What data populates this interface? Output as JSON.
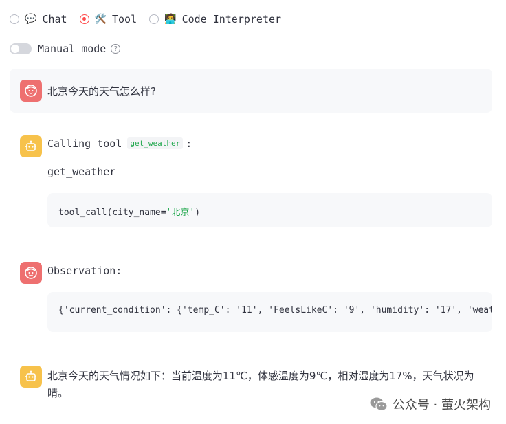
{
  "modes": [
    {
      "label": "Chat",
      "emoji": "💬",
      "selected": false
    },
    {
      "label": "Tool",
      "emoji": "🛠️",
      "selected": true
    },
    {
      "label": "Code Interpreter",
      "emoji": "🧑‍💻",
      "selected": false
    }
  ],
  "manual_mode": {
    "label": "Manual mode",
    "help": "?",
    "enabled": false
  },
  "user_message": "北京今天的天气怎么样?",
  "tool_call": {
    "heading": "Calling tool",
    "tag": "get_weather",
    "colon": ":",
    "name": "get_weather",
    "code_fn": "tool_call(city_name=",
    "code_arg": "'北京'",
    "code_close": ")"
  },
  "observation": {
    "heading": "Observation:",
    "text": "{'current_condition': {'temp_C': '11', 'FeelsLikeC': '9', 'humidity': '17', 'weatherDesc': [{'value': 'Sunny'}]}}"
  },
  "final_answer": "北京今天的天气情况如下：当前温度为11℃，体感温度为9℃，相对湿度为17%，天气状况为晴。",
  "watermark": "公众号 · 萤火架构",
  "colors": {
    "accent": "#ff4b4b",
    "user_avatar": "#ee7070",
    "bot_avatar": "#f7c24b",
    "string": "#21a84e"
  }
}
